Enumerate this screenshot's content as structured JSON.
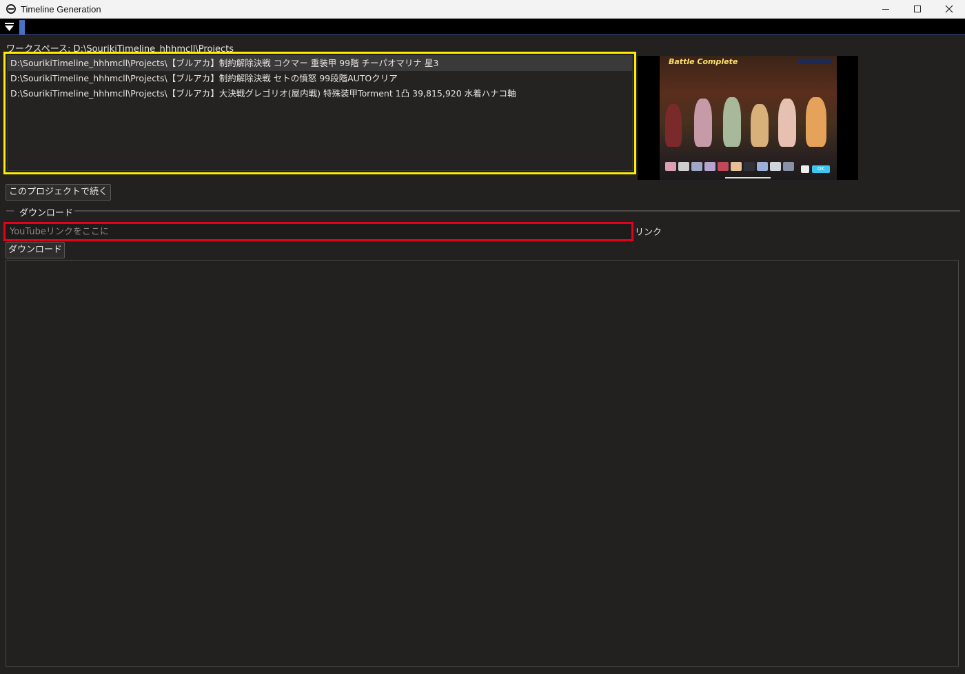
{
  "window": {
    "title": "Timeline Generation",
    "controls": {
      "minimize": "minimize-icon",
      "maximize": "maximize-icon",
      "close": "close-icon"
    }
  },
  "toolstrip": {
    "menu_icon": "triangle-menu-icon"
  },
  "workspace": {
    "label": "ワークスペース: D:\\SourikiTimeline_hhhmcll\\Projects"
  },
  "projects": {
    "items": [
      {
        "path": "D:\\SourikiTimeline_hhhmcll\\Projects\\【ブルアカ】制約解除決戦 コクマー 重装甲 99階 チーパオマリナ 星3",
        "selected": true
      },
      {
        "path": "D:\\SourikiTimeline_hhhmcll\\Projects\\【ブルアカ】制約解除決戦 セトの憤怒 99段階AUTOクリア",
        "selected": false
      },
      {
        "path": "D:\\SourikiTimeline_hhhmcll\\Projects\\【ブルアカ】大決戦グレゴリオ(屋内戦) 特殊装甲Torment 1凸 39,815,920 水着ハナコ軸",
        "selected": false
      }
    ],
    "highlight_color": "#ffec00"
  },
  "thumbnail": {
    "banner": "Battle Complete",
    "ok_label": "OK"
  },
  "continue_button": {
    "label": "このプロジェクトで続く"
  },
  "download_section": {
    "heading": "ダウンロード",
    "link_input": {
      "placeholder": "YouTubeリンクをここに",
      "value": "",
      "highlight_color": "#e5001c"
    },
    "link_label": "リンク",
    "download_button": "ダウンロード",
    "log_text": ""
  },
  "colors": {
    "background": "#232120",
    "accent": "#4a72c4"
  }
}
